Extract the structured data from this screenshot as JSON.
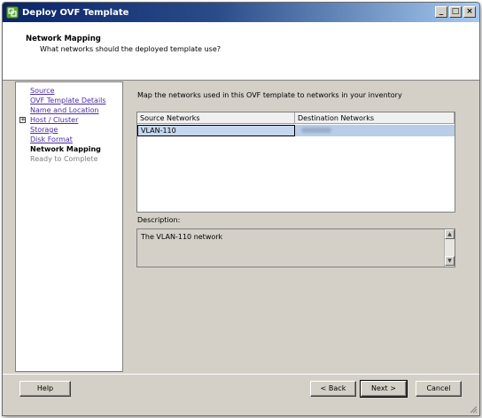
{
  "window": {
    "title": "Deploy OVF Template",
    "controls": {
      "minimize": "_",
      "maximize": "□",
      "close": "×"
    }
  },
  "header": {
    "title": "Network Mapping",
    "subtitle": "What networks should the deployed template use?"
  },
  "nav": {
    "items": [
      {
        "label": "Source",
        "state": "link"
      },
      {
        "label": "OVF Template Details",
        "state": "link"
      },
      {
        "label": "Name and Location",
        "state": "link"
      },
      {
        "label": "Host / Cluster",
        "state": "link",
        "expander": "+"
      },
      {
        "label": "Storage",
        "state": "link"
      },
      {
        "label": "Disk Format",
        "state": "link"
      },
      {
        "label": "Network Mapping",
        "state": "current"
      },
      {
        "label": "Ready to Complete",
        "state": "pending"
      }
    ]
  },
  "main": {
    "instruction": "Map the networks used in this OVF template to networks in your inventory",
    "table": {
      "columns": [
        "Source Networks",
        "Destination Networks"
      ],
      "rows": [
        {
          "source": "VLAN-110",
          "destination_redacted": true
        }
      ]
    },
    "description_label": "Description:",
    "description": "The VLAN-110 network"
  },
  "footer": {
    "help": "Help",
    "back": "< Back",
    "next": "Next >",
    "cancel": "Cancel"
  },
  "colors": {
    "titlebar_start": "#0a246a",
    "titlebar_end": "#a6caf0",
    "selection_row": "#b9cde8",
    "link": "#4b2ea3",
    "dialog_bg": "#d4d0c8"
  },
  "icons": {
    "app": "ovf-deploy-icon",
    "scroll_up": "up-arrow-icon",
    "scroll_down": "down-arrow-icon",
    "resize": "resize-grip-icon"
  }
}
